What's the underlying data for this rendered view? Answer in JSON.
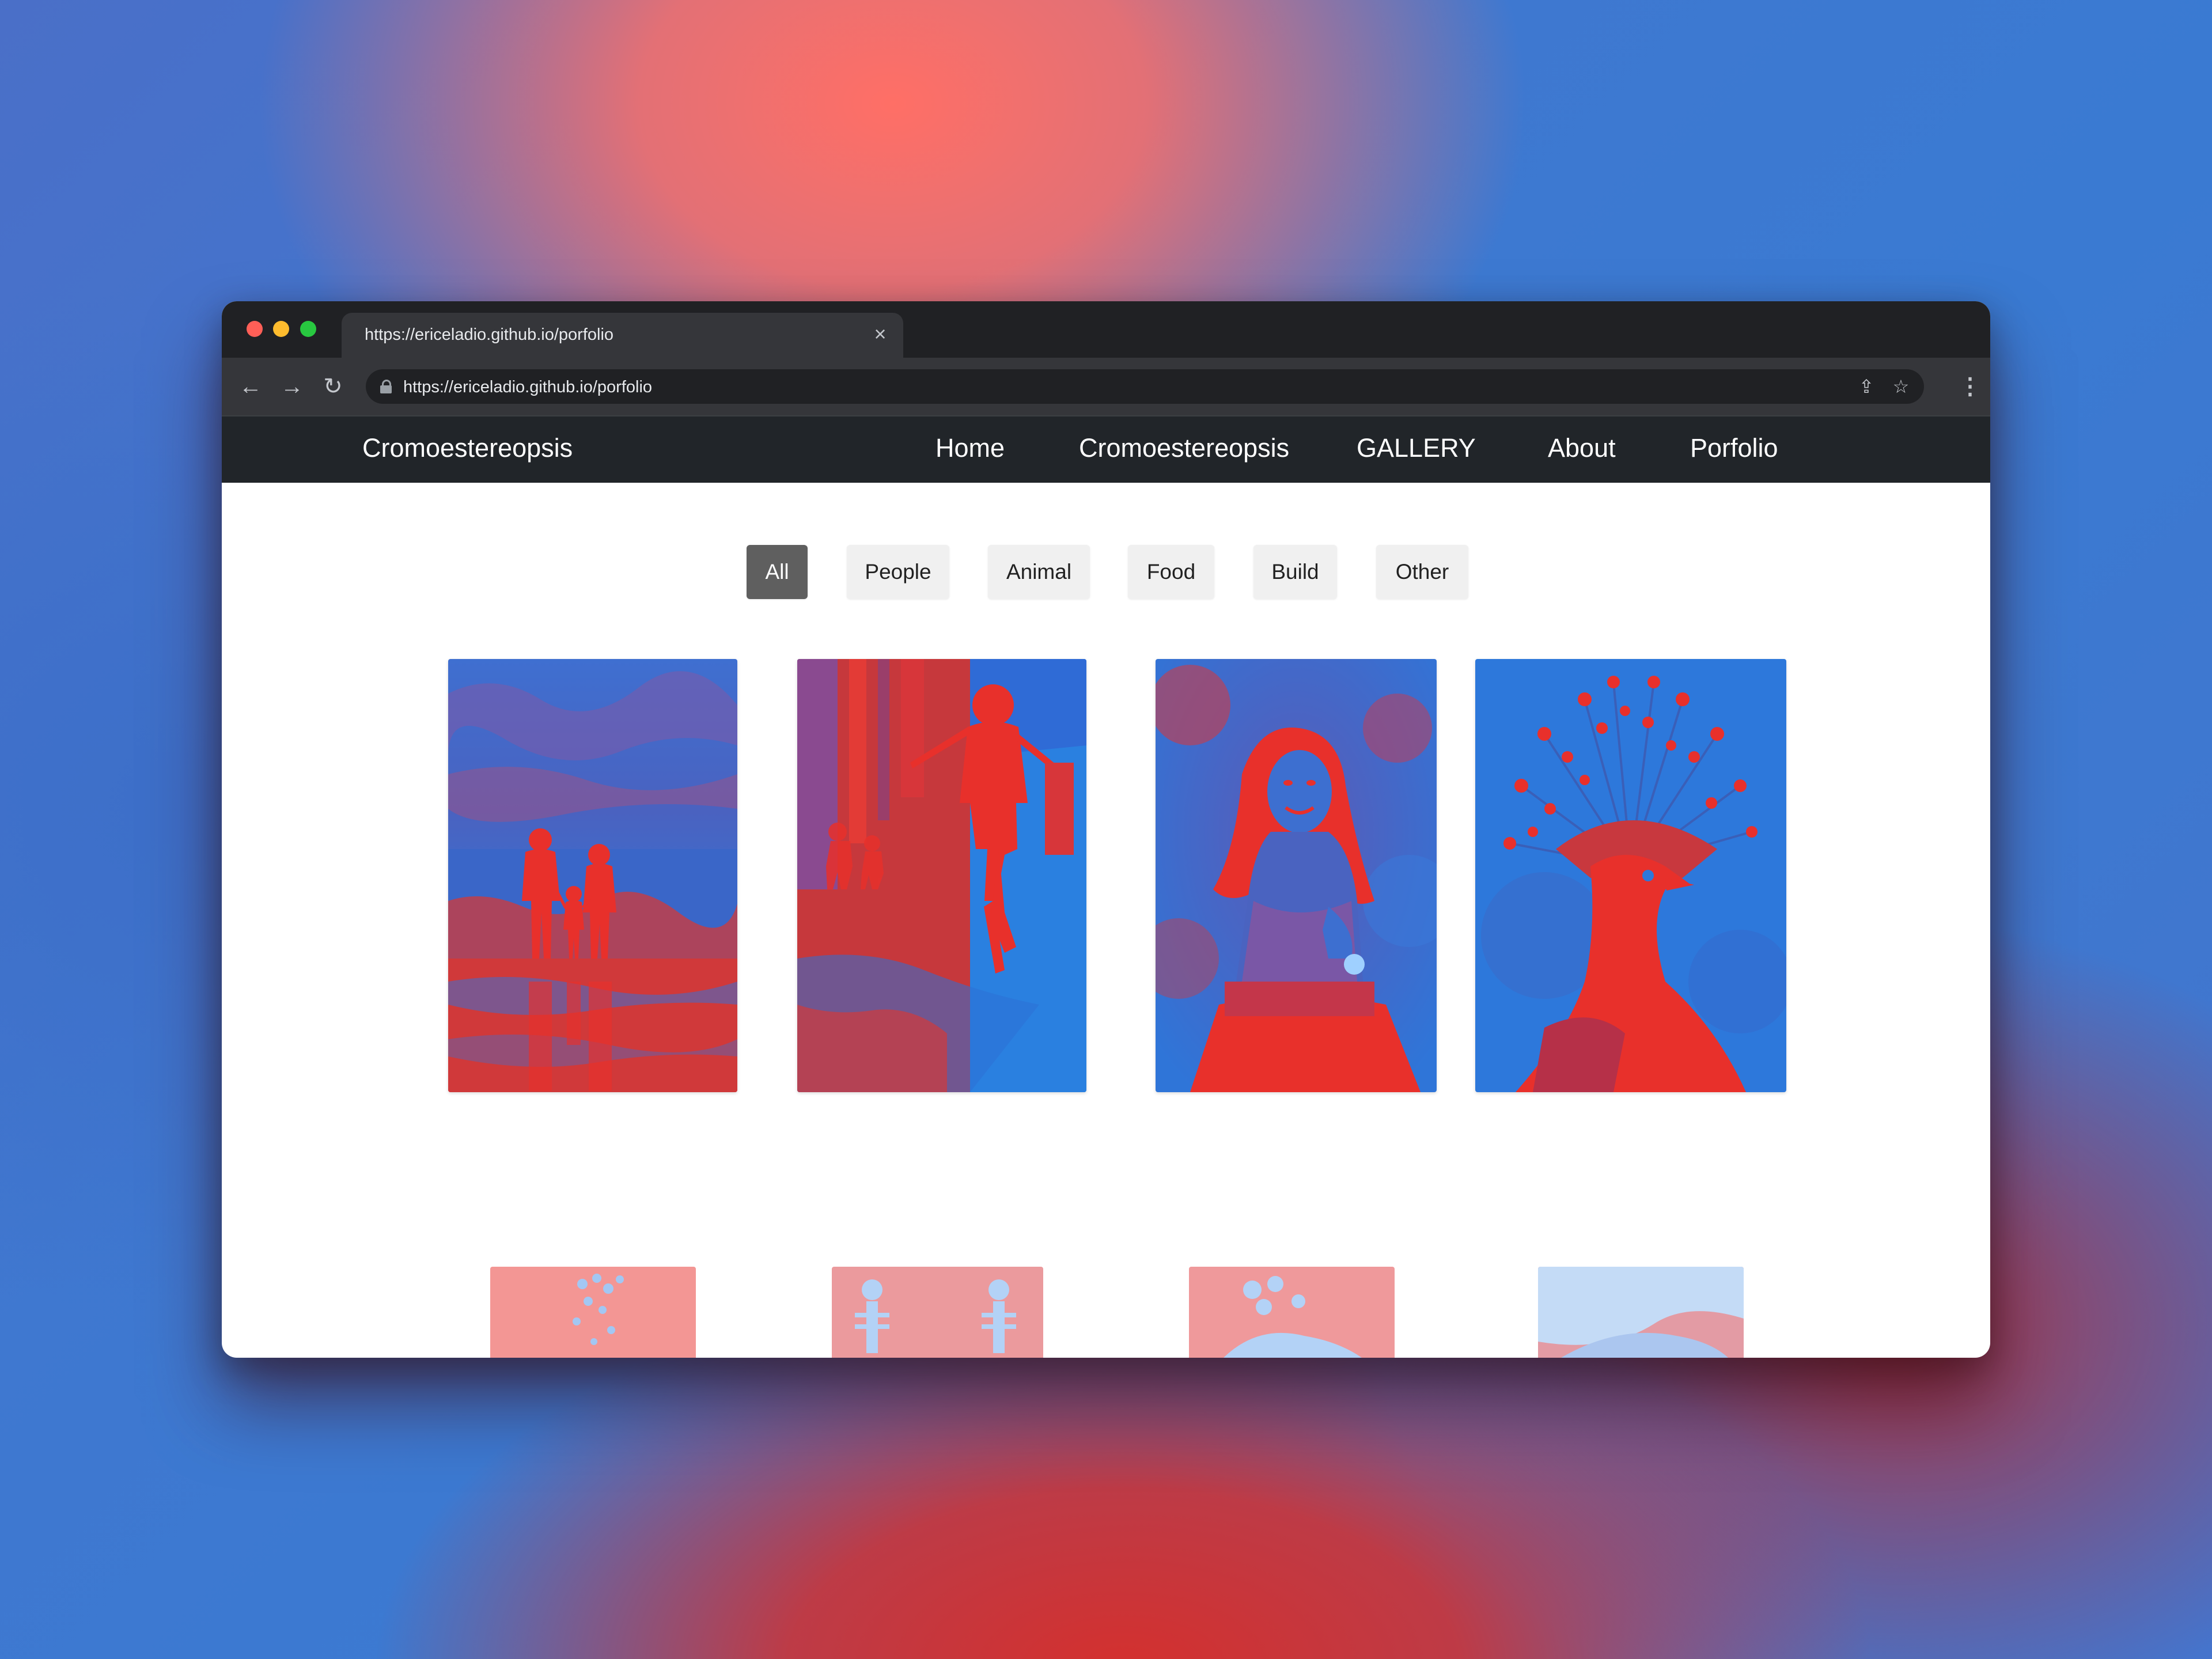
{
  "browser": {
    "tab_title": "https://ericeladio.github.io/porfolio",
    "tab_close_glyph": "×",
    "url": "https://ericeladio.github.io/porfolio",
    "icons": {
      "back": "←",
      "forward": "→",
      "reload": "↻",
      "share": "⇪",
      "star": "☆",
      "menu": "⋮"
    }
  },
  "site": {
    "brand": "Cromoestereopsis",
    "nav": [
      {
        "label": "Home"
      },
      {
        "label": "Cromoestereopsis"
      },
      {
        "label": "GALLERY"
      },
      {
        "label": "About"
      },
      {
        "label": "Porfolio"
      }
    ]
  },
  "filters": [
    {
      "label": "All",
      "active": true
    },
    {
      "label": "People",
      "active": false
    },
    {
      "label": "Animal",
      "active": false
    },
    {
      "label": "Food",
      "active": false
    },
    {
      "label": "Build",
      "active": false
    },
    {
      "label": "Other",
      "active": false
    }
  ],
  "colors": {
    "red": "#e8302b",
    "blue": "#2a7fe0",
    "nav_bg": "#212529",
    "active_filter": "#5f5f5f"
  },
  "gallery": {
    "row1": [
      "family-at-beach",
      "child-running-in-rain",
      "smiling-girl-with-flower",
      "crowned-pigeon"
    ],
    "row2": [
      "balloons-photo",
      "skeletons-photo",
      "flowers-photo",
      "animal-photo"
    ]
  }
}
